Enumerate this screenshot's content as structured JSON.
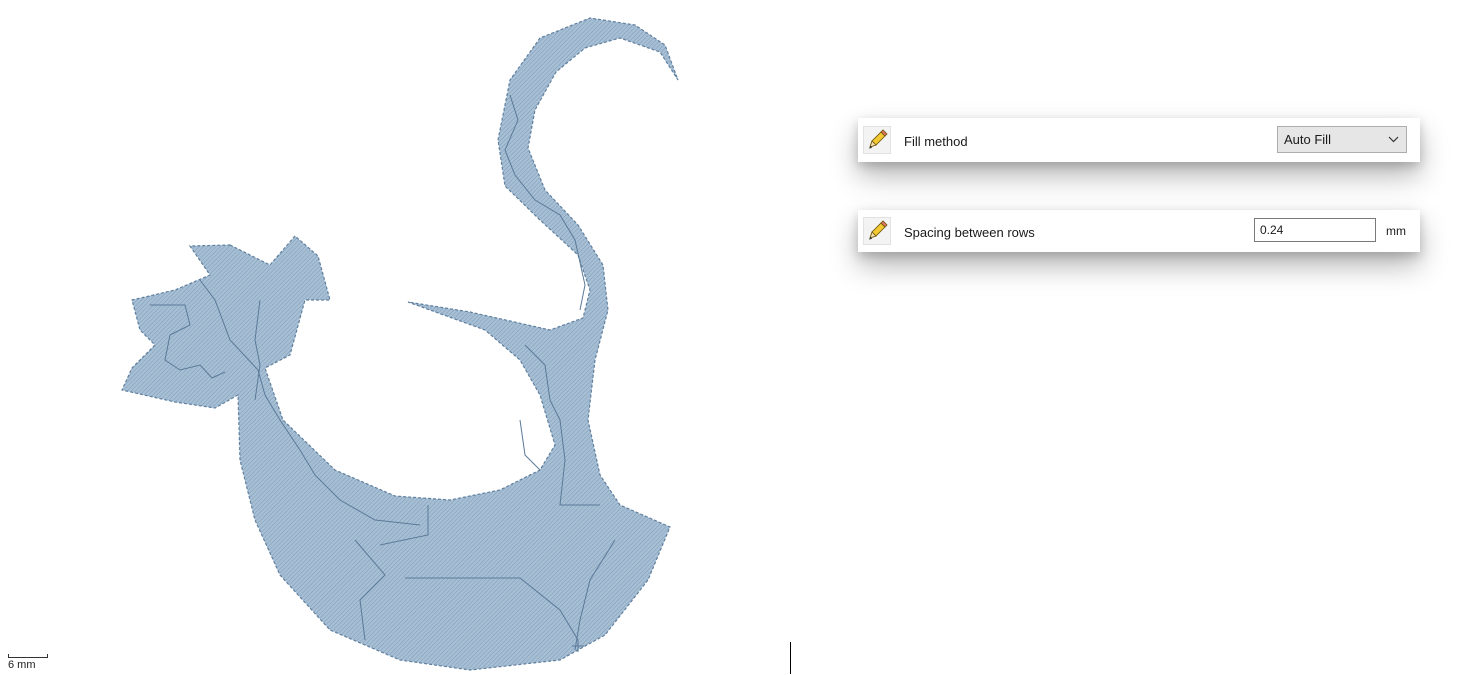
{
  "canvas": {
    "scale_label": "6 mm",
    "fill_color": "#a3bdd3",
    "stitch_color": "#5a7a99"
  },
  "properties": {
    "fill_method": {
      "label": "Fill method",
      "value": "Auto Fill",
      "icon": "pencil-icon"
    },
    "spacing": {
      "label": "Spacing between rows",
      "value": "0.24",
      "unit": "mm",
      "icon": "pencil-icon"
    }
  }
}
